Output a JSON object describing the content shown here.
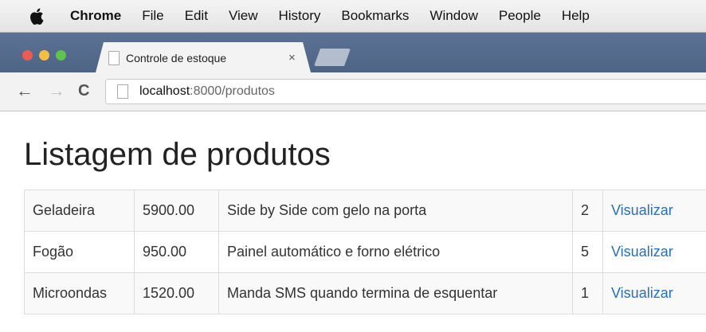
{
  "menubar": {
    "app_name": "Chrome",
    "items": [
      "File",
      "Edit",
      "View",
      "History",
      "Bookmarks",
      "Window",
      "People",
      "Help"
    ]
  },
  "tab": {
    "title": "Controle de estoque",
    "close_glyph": "×"
  },
  "toolbar": {
    "back_glyph": "←",
    "forward_glyph": "→",
    "reload_glyph": "C",
    "url_host": "localhost",
    "url_rest": ":8000/produtos"
  },
  "page": {
    "title": "Listagem de produtos",
    "view_label": "Visualizar",
    "products": [
      {
        "name": "Geladeira",
        "price": "5900.00",
        "description": "Side by Side com gelo na porta",
        "quantity": "2"
      },
      {
        "name": "Fogão",
        "price": "950.00",
        "description": "Painel automático e forno elétrico",
        "quantity": "5"
      },
      {
        "name": "Microondas",
        "price": "1520.00",
        "description": "Manda SMS quando termina de esquentar",
        "quantity": "1"
      }
    ]
  },
  "colors": {
    "tab_strip": "#5b7294",
    "link": "#2a6fb6",
    "close": "#ee5a52",
    "minimize": "#f4be40",
    "zoom": "#5fc44e"
  }
}
